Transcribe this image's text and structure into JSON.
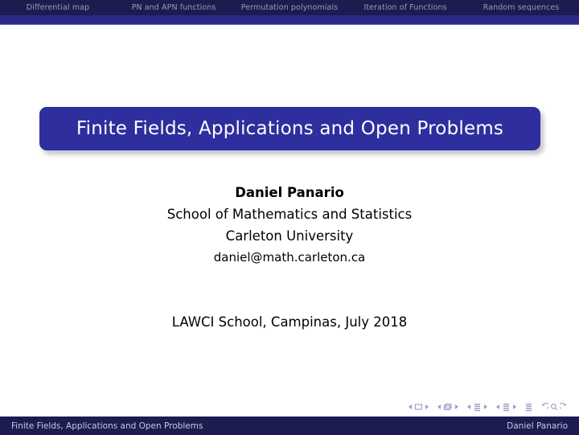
{
  "nav": {
    "items": [
      {
        "label": "Differential map"
      },
      {
        "label": "PN and APN functions"
      },
      {
        "label": "Permutation polynomials"
      },
      {
        "label": "Iteration of Functions"
      },
      {
        "label": "Random sequences"
      }
    ]
  },
  "title": {
    "text": "Finite Fields, Applications and Open Problems"
  },
  "author": {
    "name": "Daniel Panario",
    "department": "School of Mathematics and Statistics",
    "institution": "Carleton University",
    "email": "daniel@math.carleton.ca"
  },
  "event": {
    "text": "LAWCI School, Campinas, July 2018"
  },
  "nav_symbols": {
    "slide_icon": "slide-navigation-icon",
    "frame_icon": "frame-navigation-icon",
    "subsection_icon": "subsection-navigation-icon",
    "section_icon": "section-navigation-icon",
    "presentation_icon": "presentation-navigation-icon",
    "back_icon": "back-navigation-icon",
    "search_icon": "search-navigation-icon",
    "forward_icon": "forward-navigation-icon"
  },
  "footer": {
    "left": "Finite Fields, Applications and Open Problems",
    "right": "Daniel Panario"
  },
  "colors": {
    "bar_dark": "#1c1c50",
    "bar_blue": "#2b2b85",
    "banner": "#2e2e9e",
    "nav_text": "#9a9ac0",
    "footer_text": "#c8c8e4",
    "title_text": "#ffffff",
    "body_text": "#000000"
  }
}
